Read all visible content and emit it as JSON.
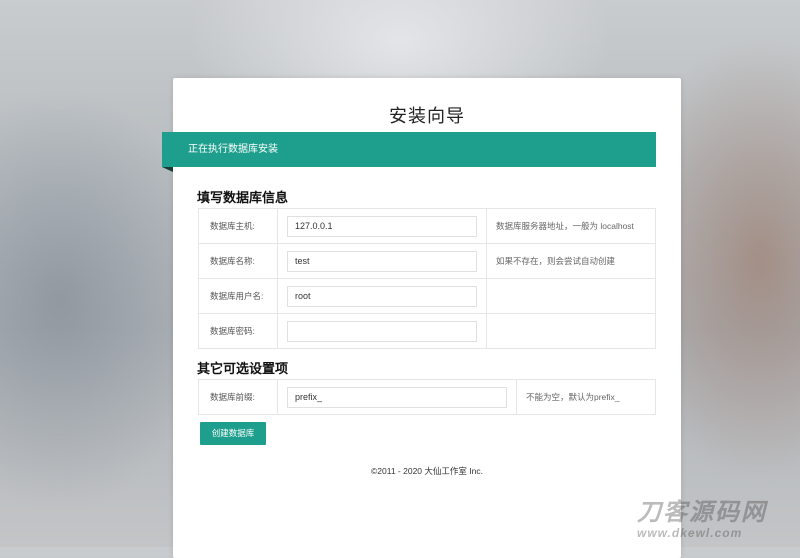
{
  "page": {
    "title": "安装向导",
    "status_banner": "正在执行数据库安装"
  },
  "db_section": {
    "heading": "填写数据库信息",
    "rows": [
      {
        "label": "数据库主机:",
        "value": "127.0.0.1",
        "help": "数据库服务器地址，一般为 localhost"
      },
      {
        "label": "数据库名称:",
        "value": "test",
        "help": "如果不存在，则会尝试自动创建"
      },
      {
        "label": "数据库用户名:",
        "value": "root",
        "help": ""
      },
      {
        "label": "数据库密码:",
        "value": "",
        "help": ""
      }
    ]
  },
  "optional_section": {
    "heading": "其它可选设置项",
    "rows": [
      {
        "label": "数据库前缀:",
        "value": "prefix_",
        "help": "不能为空，默认为prefix_"
      }
    ]
  },
  "actions": {
    "create_db_label": "创建数据库"
  },
  "footer": {
    "copyright": "©2011 - 2020 大仙工作室 Inc."
  },
  "watermark": {
    "line1": "刀客源码网",
    "line2": "www.dkewl.com"
  },
  "colors": {
    "accent": "#1e9e8c"
  }
}
